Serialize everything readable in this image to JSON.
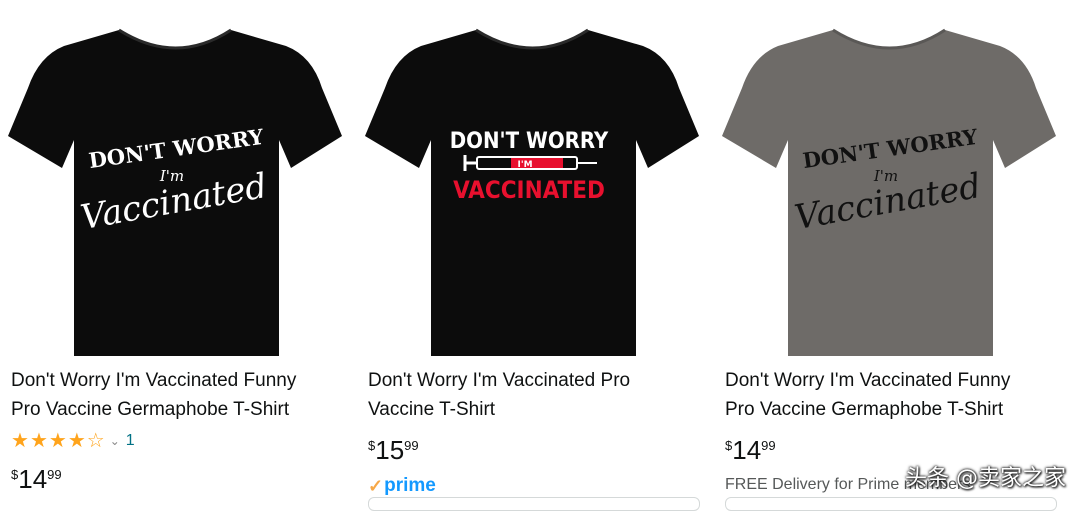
{
  "products": [
    {
      "title_line1": "Don't Worry I'm Vaccinated Funny",
      "title_line2": "Pro Vaccine Germaphobe T-Shirt",
      "shirt_color": "#0c0c0c",
      "print_color": "#ffffff",
      "print_accent": "#ffffff",
      "print_lines": [
        "DON'T WORRY",
        "I'm",
        "Vaccinated"
      ],
      "rating": 4.5,
      "rating_count": "1",
      "price_symbol": "$",
      "price_whole": "14",
      "price_fraction": "99"
    },
    {
      "title_line1": "Don't Worry I'm Vaccinated Pro",
      "title_line2": "Vaccine T-Shirt",
      "shirt_color": "#0c0c0c",
      "print_color": "#ffffff",
      "print_accent": "#e8102e",
      "print_lines": [
        "DON'T WORRY",
        "I'M",
        "VACCINATED"
      ],
      "price_symbol": "$",
      "price_whole": "15",
      "price_fraction": "99",
      "badge": "prime",
      "badge_check": "✓"
    },
    {
      "title_line1": "Don't Worry I'm Vaccinated Funny",
      "title_line2": "Pro Vaccine Germaphobe T-Shirt",
      "shirt_color": "#6e6b68",
      "print_color": "#111111",
      "print_accent": "#111111",
      "print_lines": [
        "DON'T WORRY",
        "I'm",
        "Vaccinated"
      ],
      "price_symbol": "$",
      "price_whole": "14",
      "price_fraction": "99",
      "delivery": "FREE Delivery for Prime members"
    }
  ],
  "watermark": "头条 @卖家之家"
}
